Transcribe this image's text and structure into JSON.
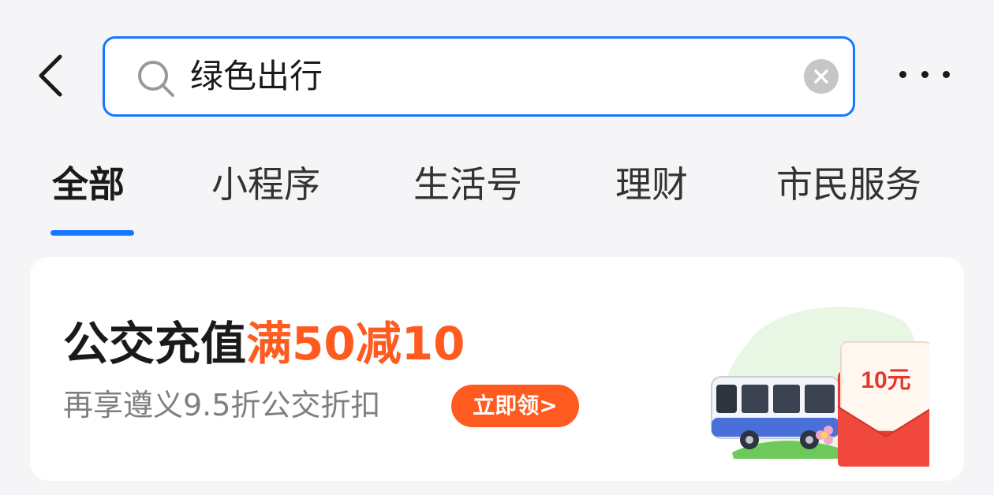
{
  "header": {
    "back_icon": "chevron-left-icon",
    "search_query": "绿色出行",
    "search_icon": "search-icon",
    "clear_icon": "clear-icon",
    "more_icon": "more-icon"
  },
  "tabs": [
    {
      "label": "全部",
      "active": true
    },
    {
      "label": "小程序",
      "active": false
    },
    {
      "label": "生活号",
      "active": false
    },
    {
      "label": "理财",
      "active": false
    },
    {
      "label": "市民服务",
      "active": false
    }
  ],
  "banner": {
    "title_main": "公交充值",
    "title_highlight": "满50减10",
    "subtitle": "再享遵义9.5折公交折扣",
    "button_label": "立即领>",
    "envelope_text": "10元"
  },
  "colors": {
    "accent_blue": "#1677ff",
    "promo_orange": "#ff5a1f",
    "background": "#f5f4f6"
  }
}
